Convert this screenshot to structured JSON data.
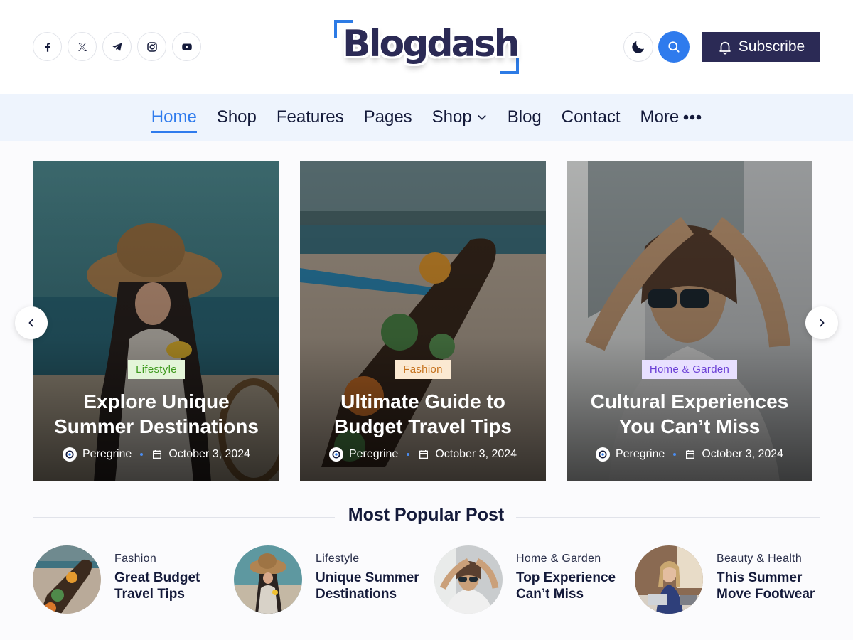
{
  "header": {
    "logo_text": "Blogdash",
    "subscribe_label": "Subscribe",
    "social": [
      "facebook-icon",
      "x-icon",
      "telegram-icon",
      "instagram-icon",
      "youtube-icon"
    ],
    "accent_color": "#2f7bed",
    "brand_color": "#2b2a55"
  },
  "nav": {
    "items": [
      {
        "label": "Home",
        "active": true
      },
      {
        "label": "Shop"
      },
      {
        "label": "Features"
      },
      {
        "label": "Pages"
      },
      {
        "label": "Shop",
        "dropdown": true
      },
      {
        "label": "Blog"
      },
      {
        "label": "Contact"
      },
      {
        "label": "More",
        "more": true
      }
    ]
  },
  "slider": {
    "cards": [
      {
        "category": "Lifestyle",
        "cat_bg": "#e4f5d9",
        "cat_color": "#3f9a1e",
        "title_line1": "Explore Unique",
        "title_line2": "Summer Destinations",
        "author": "Peregrine",
        "date": "October 3, 2024"
      },
      {
        "category": "Fashion",
        "cat_bg": "#fbe9d2",
        "cat_color": "#c5711c",
        "title_line1": "Ultimate Guide to",
        "title_line2": "Budget Travel Tips",
        "author": "Peregrine",
        "date": "October 3, 2024"
      },
      {
        "category": "Home & Garden",
        "cat_bg": "#e8e0ff",
        "cat_color": "#6b3fd6",
        "title_line1": "Cultural Experiences",
        "title_line2": "You Can’t Miss",
        "author": "Peregrine",
        "date": "October 3, 2024"
      }
    ]
  },
  "popular": {
    "heading": "Most Popular Post",
    "items": [
      {
        "category": "Fashion",
        "title_line1": "Great Budget",
        "title_line2": "Travel Tips"
      },
      {
        "category": "Lifestyle",
        "title_line1": "Unique Summer",
        "title_line2": "Destinations"
      },
      {
        "category": "Home & Garden",
        "title_line1": "Top Experience",
        "title_line2": "Can’t Miss"
      },
      {
        "category": "Beauty & Health",
        "title_line1": "This Summer",
        "title_line2": "Move Footwear"
      }
    ]
  }
}
